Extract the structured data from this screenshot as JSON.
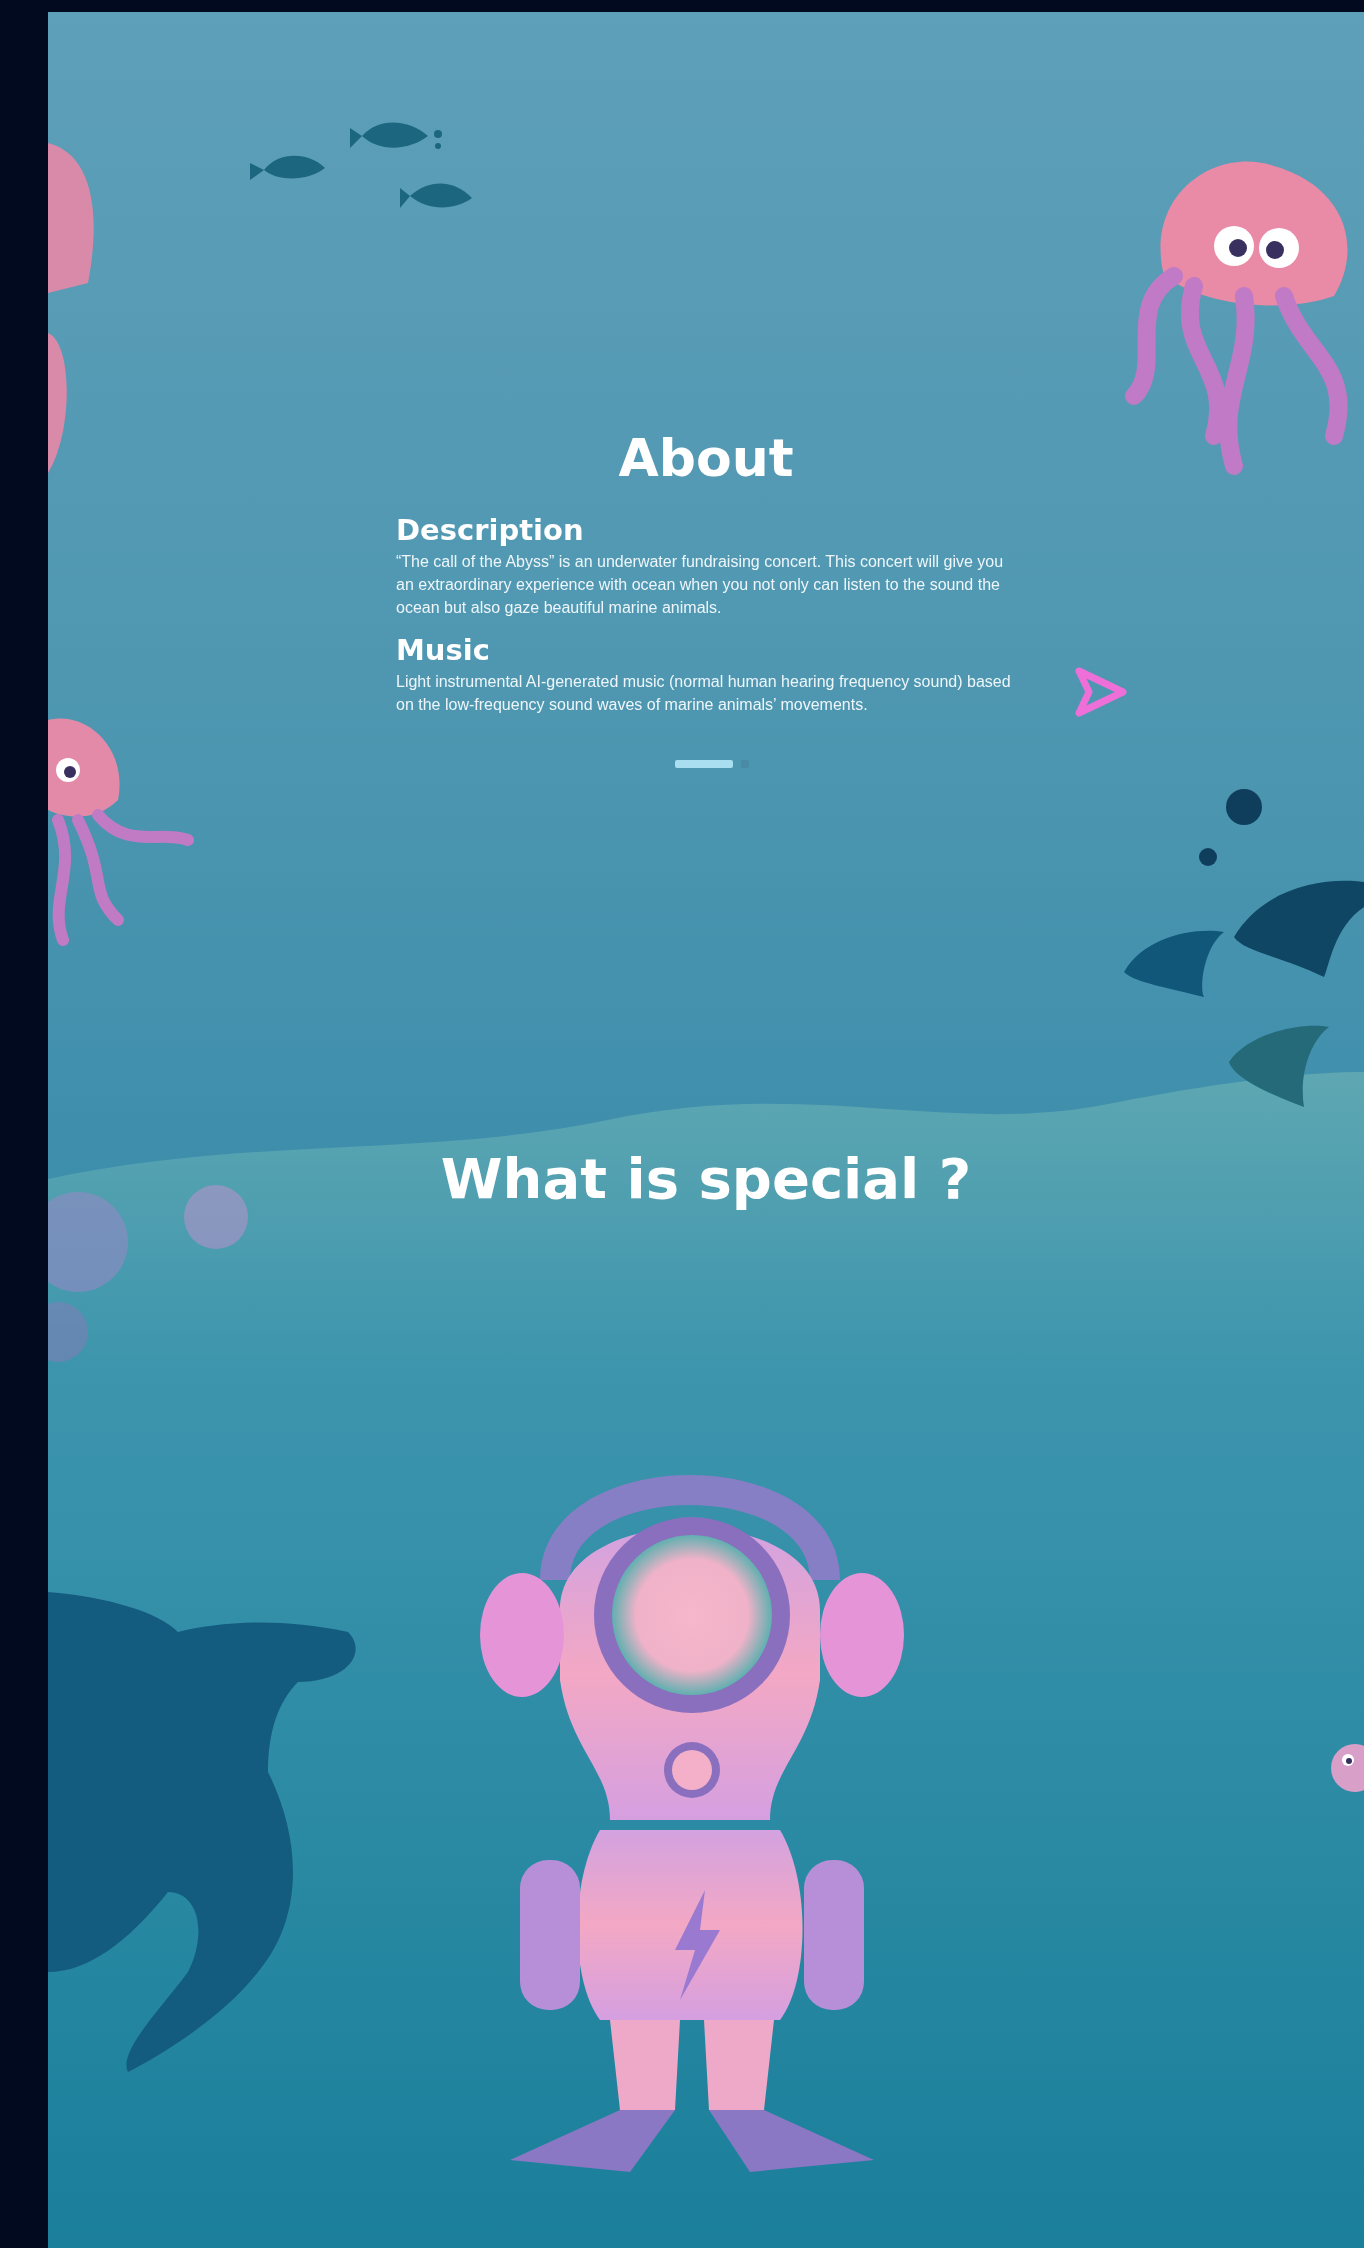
{
  "about": {
    "title": "About",
    "sections": [
      {
        "heading": "Description",
        "text": "“The call of the Abyss” is an underwater fundraising concert. This concert will give you an extraordinary experience with ocean when you not only can listen to the sound the ocean but also gaze beautiful marine animals."
      },
      {
        "heading": "Music",
        "text": "Light instrumental AI-generated music (normal human hearing frequency sound) based on the low-frequency sound waves of marine animals’ movements."
      }
    ],
    "pager": [
      {
        "selected": true
      },
      {
        "selected": false
      }
    ]
  },
  "special": {
    "title": "What is special ?"
  }
}
